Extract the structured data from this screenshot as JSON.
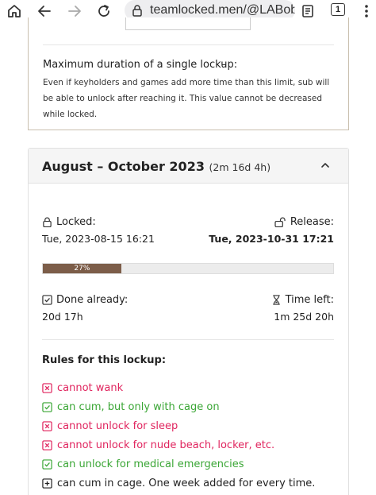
{
  "browser": {
    "url": "teamlocked.men/@LABobG/ca",
    "tab_count": "1"
  },
  "limits": {
    "max_label": "Maximum duration of a single lockup:",
    "max_value": "–",
    "max_description": "Even if keyholders and games add more time than this limit, sub will be able to unlock after reaching it. This value cannot be decreased while locked."
  },
  "lockup": {
    "title": "August – October 2023",
    "duration": "(2m 16d 4h)",
    "locked_label": "Locked:",
    "locked_value": "Tue, 2023-08-15 16:21",
    "release_label": "Release:",
    "release_value": "Tue, 2023-10-31 17:21",
    "progress_percent": 27,
    "progress_label": "27%",
    "done_label": "Done already:",
    "done_value": "20d 17h",
    "left_label": "Time left:",
    "left_value": "1m 25d 20h"
  },
  "rules": {
    "title": "Rules for this lockup:",
    "items": [
      {
        "text": "cannot wank",
        "kind": "neg"
      },
      {
        "text": "can cum, but only with cage on",
        "kind": "pos"
      },
      {
        "text": "cannot unlock for sleep",
        "kind": "neg"
      },
      {
        "text": "cannot unlock for nude beach, locker, etc.",
        "kind": "neg"
      },
      {
        "text": "can unlock for medical emergencies",
        "kind": "pos"
      },
      {
        "text": "can cum in cage. One week added for every time.",
        "kind": "neu"
      }
    ]
  },
  "colors": {
    "negative": "#e0245e",
    "positive": "#3aa635",
    "progress": "#7c5d49"
  }
}
